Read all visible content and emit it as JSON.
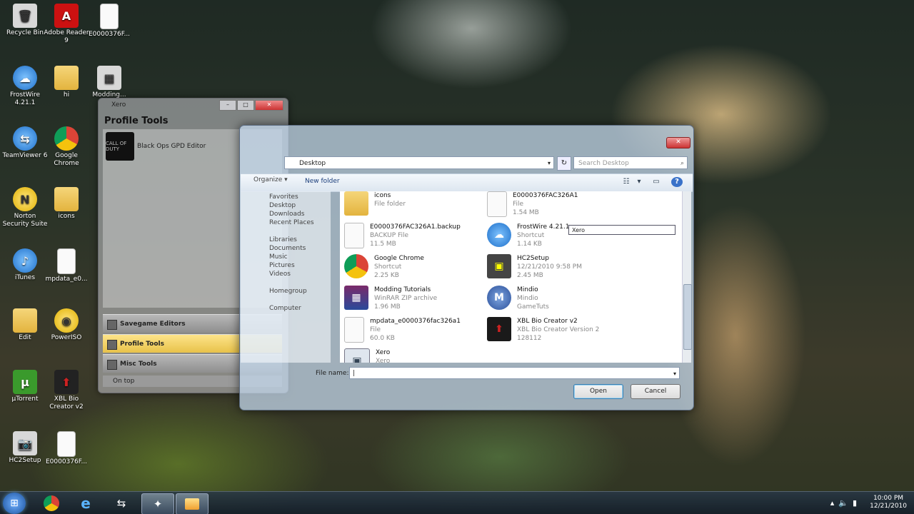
{
  "desktop": {
    "icons": [
      {
        "label": "Recycle Bin",
        "glyph": "🗑"
      },
      {
        "label": "Adobe Reader 9",
        "glyph": "A"
      },
      {
        "label": "E0000376F...",
        "glyph": ""
      },
      {
        "label": "FrostWire 4.21.1",
        "glyph": "☁"
      },
      {
        "label": "hi",
        "glyph": ""
      },
      {
        "label": "Modding...",
        "glyph": "▦"
      },
      {
        "label": "TeamViewer 6",
        "glyph": "⇆"
      },
      {
        "label": "Google Chrome",
        "glyph": ""
      },
      {
        "label": "Norton Security Suite",
        "glyph": "N"
      },
      {
        "label": "icons",
        "glyph": ""
      },
      {
        "label": "iTunes",
        "glyph": "♪"
      },
      {
        "label": "mpdata_e0...",
        "glyph": ""
      },
      {
        "label": "Edit",
        "glyph": ""
      },
      {
        "label": "PowerISO",
        "glyph": "◉"
      },
      {
        "label": "µTorrent",
        "glyph": "µ"
      },
      {
        "label": "XBL Bio Creator v2",
        "glyph": "⬆"
      },
      {
        "label": "HC2Setup",
        "glyph": "📷"
      },
      {
        "label": "E0000376F..."
      }
    ]
  },
  "xero": {
    "title": "Xero",
    "panel_title": "Profile Tools",
    "tool_label": "Black Ops GPD Editor",
    "tool_thumb": "CALL OF DUTY",
    "nav": [
      "Savegame Editors",
      "Profile Tools",
      "Misc Tools"
    ],
    "status": "On top"
  },
  "dialog": {
    "address": "Desktop",
    "search_placeholder": "Search Desktop",
    "new_folder": "New folder",
    "nav_items": [
      "Organize ▾",
      "Favorites",
      "Desktop",
      "Downloads",
      "Recent Places",
      "",
      "Libraries",
      "Documents",
      "Music",
      "Pictures",
      "Videos",
      "",
      "Homegroup",
      "",
      "Computer"
    ],
    "files": [
      {
        "name": "icons",
        "line2": "File folder",
        "line3": "",
        "icon": "folder"
      },
      {
        "name": "E0000376FAC326A1.backup",
        "line2": "BACKUP File",
        "line3": "11.5 MB",
        "icon": "file"
      },
      {
        "name": "Google Chrome",
        "line2": "Shortcut",
        "line3": "2.25 KB",
        "icon": "chrome"
      },
      {
        "name": "Modding Tutorials",
        "line2": "WinRAR ZIP archive",
        "line3": "1.96 MB",
        "icon": "rar"
      },
      {
        "name": "mpdata_e0000376fac326a1",
        "line2": "File",
        "line3": "60.0 KB",
        "icon": "file"
      },
      {
        "name": "Xero",
        "line2": "Xero",
        "line3": "",
        "icon": "xero"
      },
      {
        "name": "E0000376FAC326A1",
        "line2": "File",
        "line3": "1.54 MB",
        "icon": "file"
      },
      {
        "name": "FrostWire 4.21.1",
        "line2": "Shortcut",
        "line3": "1.14 KB",
        "icon": "frostwire"
      },
      {
        "name": "HC2Setup",
        "line2": "12/21/2010 9:58 PM",
        "line3": "2.45 MB",
        "icon": "camera"
      },
      {
        "name": "Mindio",
        "line2": "Mindio",
        "line3": "GameTuts",
        "icon": "m"
      },
      {
        "name": "XBL Bio Creator v2",
        "line2": "XBL Bio Creator Version 2",
        "line3": "128112",
        "icon": "xbl"
      }
    ],
    "rename_text": "Xero",
    "filename_label": "File name:",
    "filename_value": "|",
    "open_label": "Open",
    "cancel_label": "Cancel"
  },
  "taskbar": {
    "time": "10:00 PM",
    "date": "12/21/2010"
  }
}
